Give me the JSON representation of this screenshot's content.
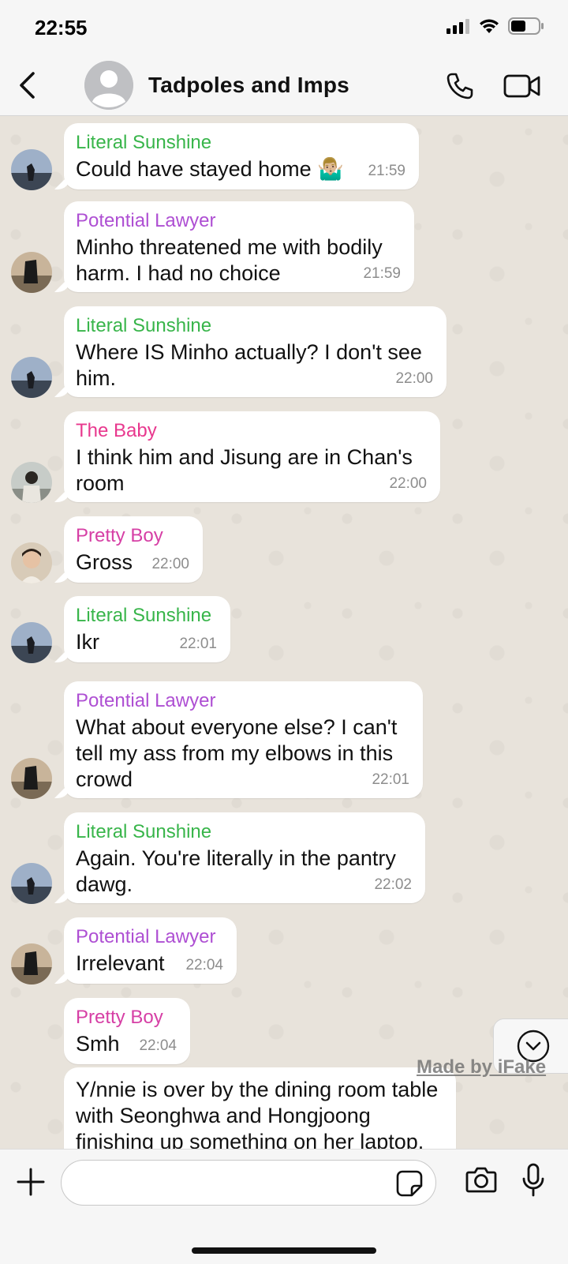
{
  "status_bar": {
    "time": "22:55"
  },
  "header": {
    "title": "Tadpoles and Imps"
  },
  "colors": {
    "literal_sunshine": "#38b54a",
    "potential_lawyer": "#ae4fd3",
    "the_baby": "#e8388e",
    "pretty_boy": "#d63fa5"
  },
  "messages": [
    {
      "sender": "Literal Sunshine",
      "text": "Could have stayed home 🤷🏼‍♂️",
      "time": "21:59"
    },
    {
      "sender": "Potential Lawyer",
      "text": "Minho threatened me with bodily harm. I had no choice",
      "time": "21:59"
    },
    {
      "sender": "Literal Sunshine",
      "text": "Where IS Minho actually? I don't see him.",
      "time": "22:00"
    },
    {
      "sender": "The Baby",
      "text": "I think him and Jisung are in Chan's room",
      "time": "22:00"
    },
    {
      "sender": "Pretty Boy",
      "text": "Gross",
      "time": "22:00"
    },
    {
      "sender": "Literal Sunshine",
      "text": "Ikr",
      "time": "22:01"
    },
    {
      "sender": "Potential Lawyer",
      "text": "What about everyone else? I can't tell my ass from my elbows in this crowd",
      "time": "22:01"
    },
    {
      "sender": "Literal Sunshine",
      "text": "Again. You're literally in the pantry dawg.",
      "time": "22:02"
    },
    {
      "sender": "Potential Lawyer",
      "text": "Irrelevant",
      "time": "22:04"
    },
    {
      "sender": "Pretty Boy",
      "text": "Smh",
      "time": "22:04"
    },
    {
      "sender": "",
      "text": "Y/nnie is over by the dining room table with Seonghwa and Hongjoong finishing up something on her laptop.",
      "time": ""
    }
  ],
  "watermark": "Made by iFake",
  "composer": {
    "placeholder": ""
  }
}
